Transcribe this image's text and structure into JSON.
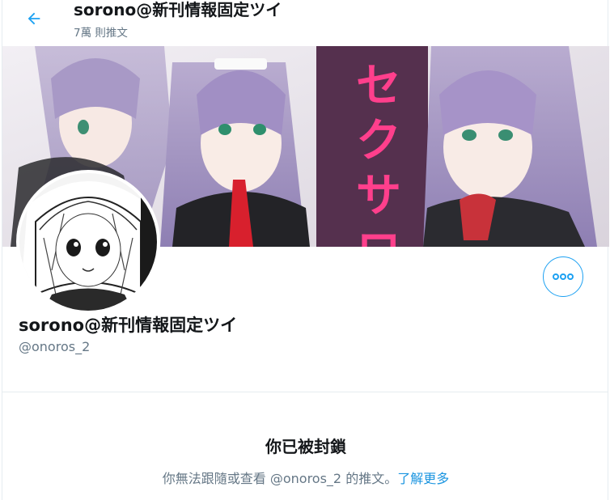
{
  "header": {
    "title": "sorono@新刊情報固定ツイ",
    "tweet_count": "7萬 則推文"
  },
  "banner": {
    "katakana_text": [
      "セ",
      "ク",
      "サ",
      "ロ"
    ]
  },
  "profile": {
    "display_name": "sorono@新刊情報固定ツイ",
    "handle": "@onoros_2"
  },
  "blocked": {
    "title": "你已被封鎖",
    "message": "你無法跟隨或查看 @onoros_2 的推文。",
    "learn_more": "了解更多"
  },
  "colors": {
    "accent": "#1da1f2",
    "link": "#1b95e0",
    "secondary_text": "#657786",
    "banner_panel": "#4b2a45",
    "banner_text": "#ff3f8c"
  },
  "icons": {
    "back": "arrow-left-icon",
    "more": "more-dots-icon"
  }
}
